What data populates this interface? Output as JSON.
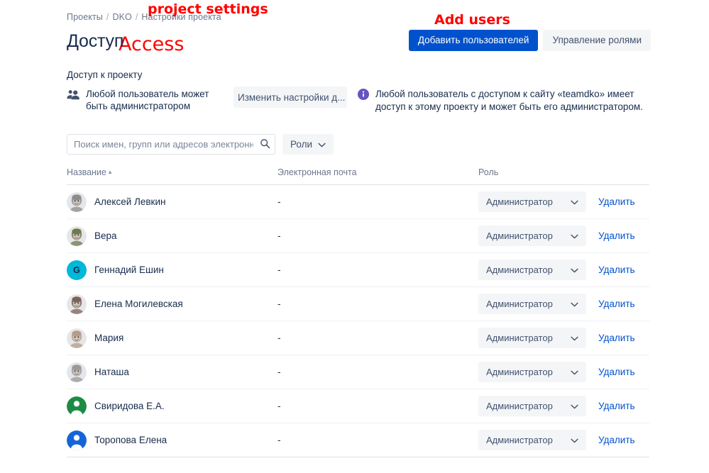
{
  "breadcrumb": {
    "items": [
      "Проекты",
      "DKO",
      "Настройки проекта"
    ],
    "separator": "/"
  },
  "annotations": [
    {
      "text": "project settings",
      "color": "#ff0000"
    },
    {
      "text": "Access",
      "color": "#ff0000"
    },
    {
      "text": "Add users",
      "color": "#ff0000"
    }
  ],
  "page": {
    "title": "Доступ"
  },
  "top_actions": {
    "add_users_label": "Добавить пользователей",
    "manage_roles_label": "Управление ролями",
    "primary_color": "#0052cc"
  },
  "access_section": {
    "label": "Доступ к проекту",
    "summary": "Любой пользователь может быть администратором",
    "change_settings_label": "Изменить настройки д...",
    "info_icon": "info-icon",
    "info_color": "#6554c0",
    "info_text": "Любой пользователь с доступом к сайту «teamdko» имеет доступ к этому проекту и может быть его администратором."
  },
  "filters": {
    "search_placeholder": "Поиск имен, групп или адресов электронной",
    "search_value": "",
    "search_icon": "search-icon",
    "roles_label": "Роли",
    "roles_caret": "chevron-down-icon"
  },
  "table": {
    "columns": {
      "name": "Название",
      "email": "Электронная почта",
      "role": "Роль"
    },
    "sort_indicator": "▴",
    "remove_label": "Удалить",
    "rows": [
      {
        "name": "Алексей Левкин",
        "email": "-",
        "role": "Администратор",
        "avatar_type": "photo",
        "avatar_color": "#8c8c8c",
        "initial": ""
      },
      {
        "name": "Вера",
        "email": "-",
        "role": "Администратор",
        "avatar_type": "photo",
        "avatar_color": "#6f7a4a",
        "initial": ""
      },
      {
        "name": "Геннадий Ешин",
        "email": "-",
        "role": "Администратор",
        "avatar_type": "initial",
        "avatar_color": "#00b8d9",
        "initial": "G"
      },
      {
        "name": "Елена Могилевская",
        "email": "-",
        "role": "Администратор",
        "avatar_type": "photo",
        "avatar_color": "#7d6357",
        "initial": ""
      },
      {
        "name": "Мария",
        "email": "-",
        "role": "Администратор",
        "avatar_type": "photo",
        "avatar_color": "#b79d86",
        "initial": ""
      },
      {
        "name": "Наташа",
        "email": "-",
        "role": "Администратор",
        "avatar_type": "photo",
        "avatar_color": "#9a9a9a",
        "initial": ""
      },
      {
        "name": "Свиридова Е.А.",
        "email": "-",
        "role": "Администратор",
        "avatar_type": "person",
        "avatar_color": "#1c8c44",
        "initial": ""
      },
      {
        "name": "Торопова Елена",
        "email": "-",
        "role": "Администратор",
        "avatar_type": "person",
        "avatar_color": "#1565d8",
        "initial": ""
      }
    ]
  }
}
